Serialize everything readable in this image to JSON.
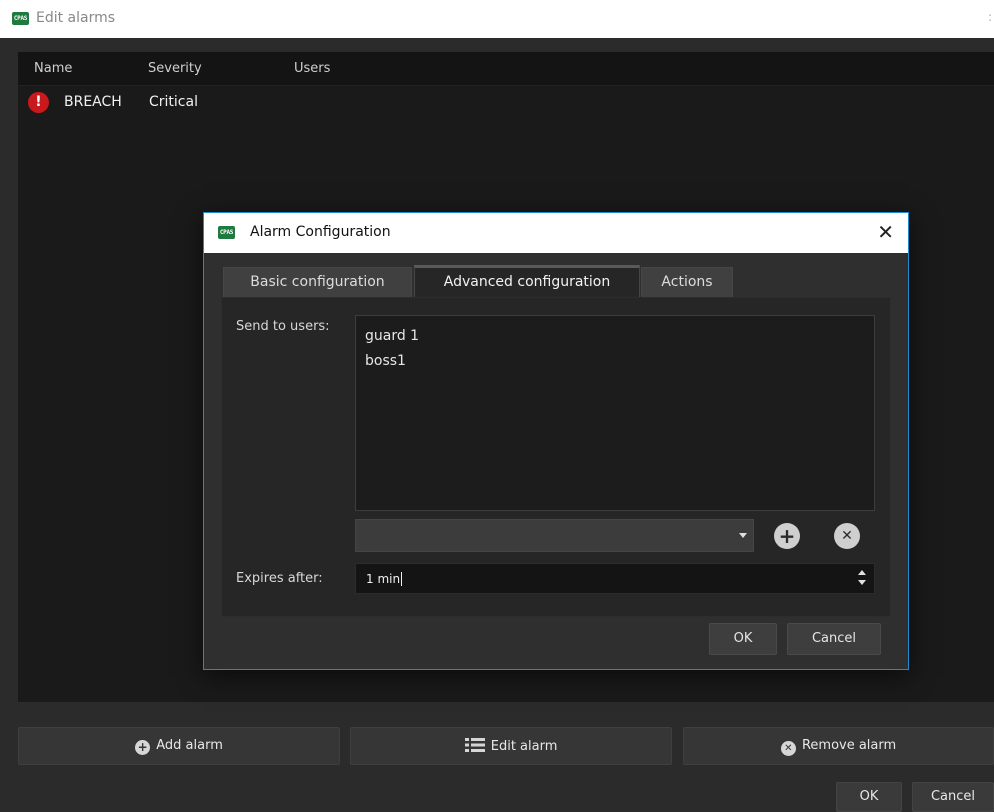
{
  "window": {
    "logo_text": "CPAS",
    "title": "Edit alarms",
    "edge_glyph": ":"
  },
  "table": {
    "columns": [
      "Name",
      "Severity",
      "Users"
    ],
    "rows": [
      {
        "icon": "critical-alert-icon",
        "icon_glyph": "!",
        "name": "BREACH",
        "severity": "Critical",
        "users": ""
      }
    ]
  },
  "actions": {
    "add_alarm": "Add alarm",
    "add_glyph": "+",
    "edit_alarm": "Edit alarm",
    "remove_alarm": "Remove alarm",
    "remove_glyph": "✕"
  },
  "footer": {
    "ok": "OK",
    "cancel": "Cancel"
  },
  "dialog": {
    "logo_text": "CPAS",
    "title": "Alarm Configuration",
    "close_glyph": "✕",
    "tabs": [
      "Basic configuration",
      "Advanced configuration",
      "Actions"
    ],
    "active_tab": "Advanced configuration",
    "send_to_users_label": "Send to users:",
    "users": [
      "guard 1",
      "boss1"
    ],
    "user_combo_value": "",
    "add_user_glyph": "+",
    "remove_user_glyph": "✕",
    "expires_after_label": "Expires after:",
    "expires_after_value": "1 min",
    "ok": "OK",
    "cancel": "Cancel"
  },
  "colors": {
    "accent_border": "#1e8ad6",
    "critical": "#c8191d",
    "logo_green": "#1f7a3f"
  }
}
